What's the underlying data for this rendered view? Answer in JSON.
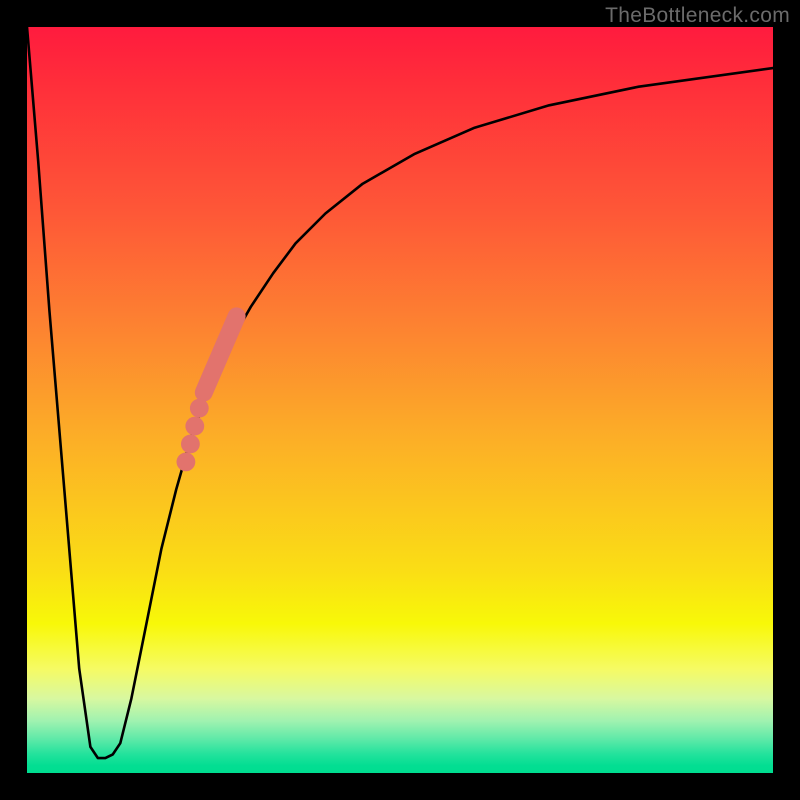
{
  "watermark": "TheBottleneck.com",
  "colors": {
    "frame": "#000000",
    "curve_stroke": "#000000",
    "marker_fill": "#e2736d",
    "gradient_top": "#ff1b3e",
    "gradient_bottom": "#00df92"
  },
  "chart_data": {
    "type": "line",
    "title": "",
    "xlabel": "",
    "ylabel": "",
    "xlim": [
      0,
      100
    ],
    "ylim": [
      0,
      100
    ],
    "grid": false,
    "legend": false,
    "series": [
      {
        "name": "bottleneck-curve",
        "x": [
          0,
          1.5,
          3,
          5,
          7,
          8.5,
          9.5,
          10.5,
          11.5,
          12.5,
          14,
          16,
          18,
          20,
          22,
          24,
          26,
          28,
          30,
          33,
          36,
          40,
          45,
          52,
          60,
          70,
          82,
          100
        ],
        "y": [
          100,
          82,
          62,
          38,
          14,
          3.5,
          2,
          2,
          2.5,
          4,
          10,
          20,
          30,
          38,
          45,
          50.5,
          55,
          59,
          62.5,
          67,
          71,
          75,
          79,
          83,
          86.5,
          89.5,
          92,
          94.5
        ]
      }
    ],
    "markers": [
      {
        "name": "highlight-dot",
        "x": 21.3,
        "y": 41.7,
        "r": 0.9
      },
      {
        "name": "highlight-dot",
        "x": 21.9,
        "y": 44.1,
        "r": 0.9
      },
      {
        "name": "highlight-dot",
        "x": 22.5,
        "y": 46.5,
        "r": 0.9
      },
      {
        "name": "highlight-dot",
        "x": 23.1,
        "y": 48.9,
        "r": 0.9
      },
      {
        "name": "highlight-segment-start",
        "x": 23.7,
        "y": 51.0,
        "r": 1.3
      },
      {
        "name": "highlight-segment-end",
        "x": 28.1,
        "y": 61.2,
        "r": 1.3
      }
    ]
  }
}
